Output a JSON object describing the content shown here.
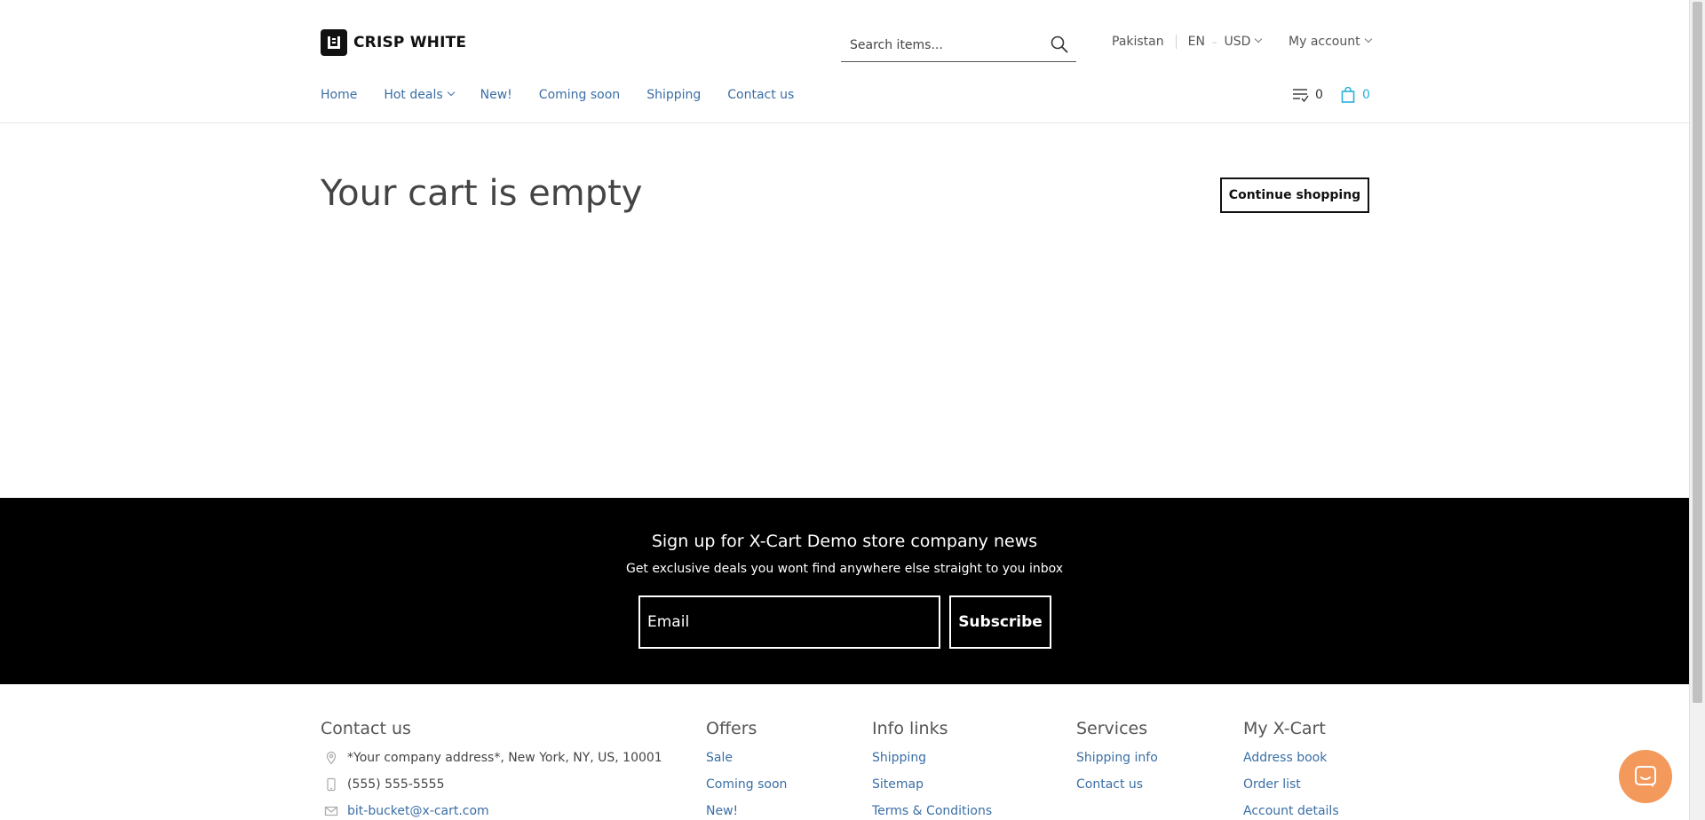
{
  "header": {
    "logo_text": "CRISP WHITE",
    "search_placeholder": "Search items...",
    "country": "Pakistan",
    "language": "EN",
    "currency": "USD",
    "account_label": "My account",
    "compare_count": "0",
    "cart_count": "0",
    "accent_color": "#2bb1d8"
  },
  "nav": {
    "items": [
      {
        "label": "Home"
      },
      {
        "label": "Hot deals"
      },
      {
        "label": "New!"
      },
      {
        "label": "Coming soon"
      },
      {
        "label": "Shipping"
      },
      {
        "label": "Contact us"
      }
    ]
  },
  "main": {
    "title": "Your cart is empty",
    "continue_label": "Continue shopping"
  },
  "newsletter": {
    "title": "Sign up for X-Cart Demo store company news",
    "subtitle": "Get exclusive deals you wont find anywhere else straight to you inbox",
    "email_placeholder": "Email",
    "subscribe_label": "Subscribe"
  },
  "footer": {
    "contact": {
      "heading": "Contact us",
      "address": "*Your company address*, New York, NY, US, 10001",
      "phone": "(555) 555-5555",
      "email": "bit-bucket@x-cart.com"
    },
    "offers": {
      "heading": "Offers",
      "links": [
        "Sale",
        "Coming soon",
        "New!"
      ]
    },
    "info": {
      "heading": "Info links",
      "links": [
        "Shipping",
        "Sitemap",
        "Terms & Conditions"
      ]
    },
    "services": {
      "heading": "Services",
      "links": [
        "Shipping info",
        "Contact us"
      ]
    },
    "myxcart": {
      "heading": "My X-Cart",
      "links": [
        "Address book",
        "Order list",
        "Account details"
      ]
    }
  }
}
